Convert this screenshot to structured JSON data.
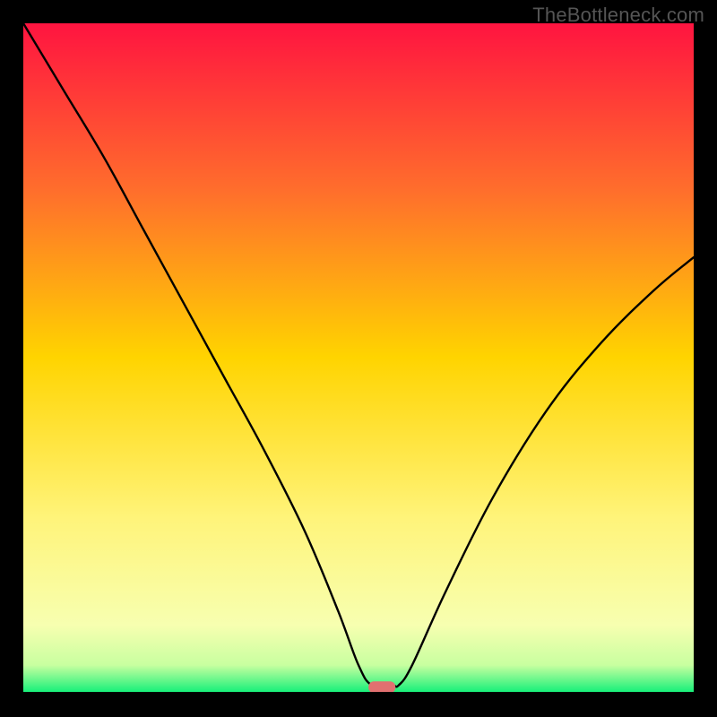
{
  "watermark": "TheBottleneck.com",
  "chart_data": {
    "type": "line",
    "title": "",
    "xlabel": "",
    "ylabel": "",
    "xlim": [
      0,
      100
    ],
    "ylim": [
      0,
      100
    ],
    "grid": false,
    "legend": false,
    "background_gradient": {
      "orientation": "vertical",
      "stops": [
        {
          "offset": 0,
          "color": "#ff1440"
        },
        {
          "offset": 25,
          "color": "#ff6e2c"
        },
        {
          "offset": 50,
          "color": "#ffd400"
        },
        {
          "offset": 74,
          "color": "#fff47a"
        },
        {
          "offset": 90,
          "color": "#f7ffb0"
        },
        {
          "offset": 96,
          "color": "#c8ffa0"
        },
        {
          "offset": 100,
          "color": "#18f07a"
        }
      ]
    },
    "series": [
      {
        "name": "bottleneck-curve",
        "x": [
          0,
          6,
          12,
          18,
          24,
          30,
          36,
          42,
          47,
          50,
          52,
          55,
          56,
          58,
          63,
          70,
          78,
          86,
          94,
          100
        ],
        "y": [
          100,
          90,
          80,
          69,
          58,
          47,
          36,
          24,
          12,
          4,
          1,
          1,
          1,
          4,
          15,
          29,
          42,
          52,
          60,
          65
        ]
      }
    ],
    "marker": {
      "name": "optimal-point",
      "x": 53.5,
      "y": 0.7,
      "color": "#e17070",
      "shape": "rounded-rect"
    }
  }
}
